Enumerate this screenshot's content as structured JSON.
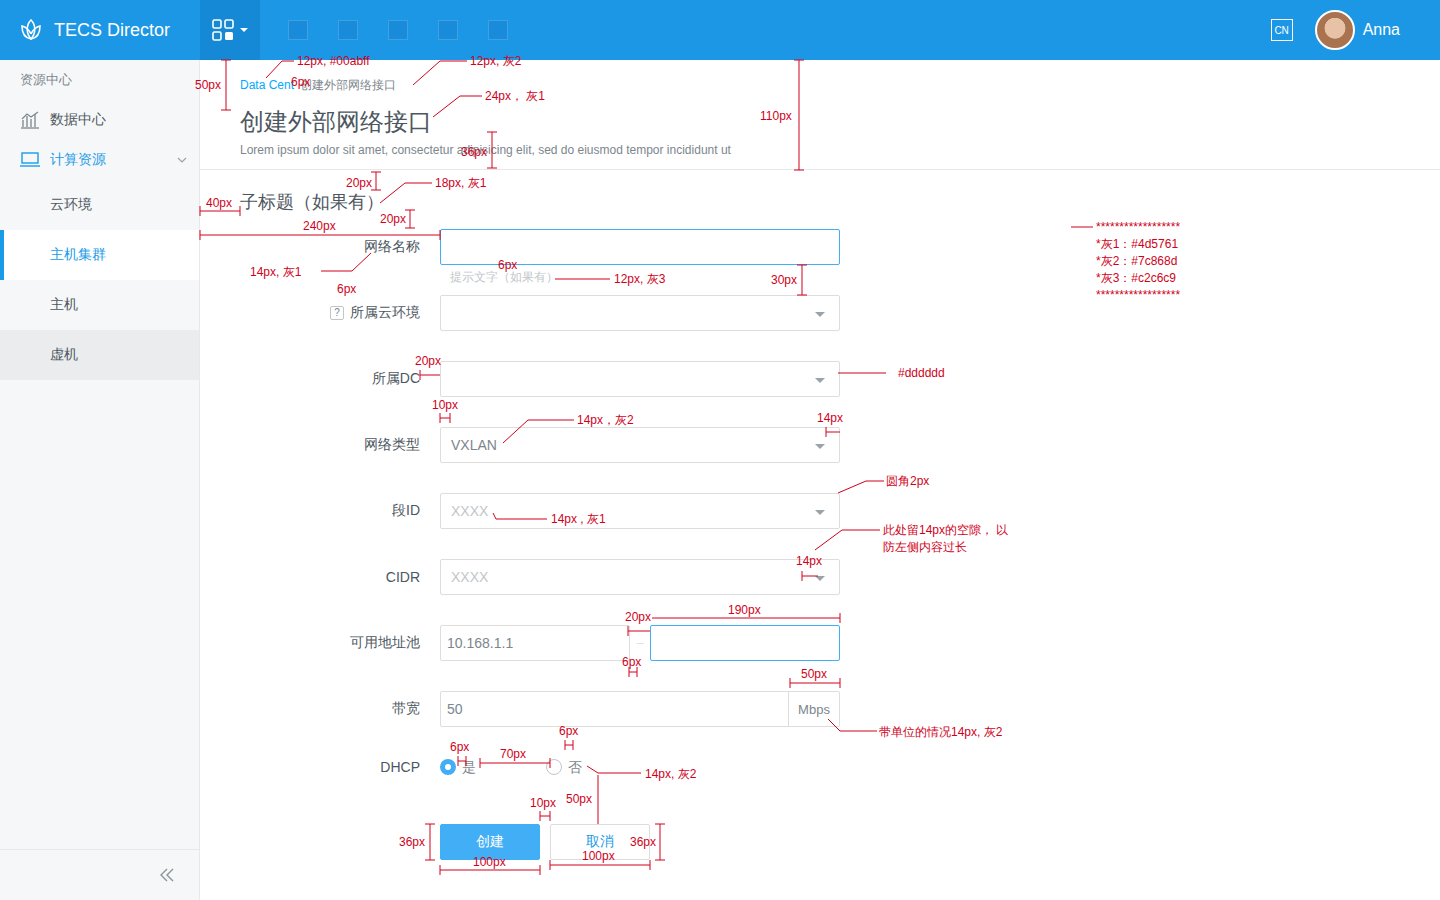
{
  "header": {
    "product": "TECS Director",
    "lang": "CN",
    "user": "Anna"
  },
  "sidebar": {
    "section": "资源中心",
    "items": [
      {
        "label": "数据中心",
        "selected": false,
        "expanded": false,
        "children": []
      },
      {
        "label": "计算资源",
        "selected": true,
        "expanded": true,
        "children": [
          {
            "label": "云环境",
            "selected": false,
            "hovered": false
          },
          {
            "label": "主机集群",
            "selected": true,
            "hovered": false
          },
          {
            "label": "主机",
            "selected": false,
            "hovered": false
          },
          {
            "label": "虚机",
            "selected": false,
            "hovered": true
          }
        ]
      }
    ]
  },
  "breadcrumb": [
    {
      "label": "Data Cent",
      "link": true
    },
    {
      "label": "创建外部网络接口",
      "link": false
    }
  ],
  "page": {
    "title": "创建外部网络接口",
    "description": "Lorem ipsum dolor sit amet, consectetur adipisicing elit, sed do eiusmod tempor incididunt ut",
    "subtitle": "子标题（如果有）"
  },
  "form": {
    "rows": [
      {
        "label": "网络名称",
        "kind": "text",
        "value": "",
        "placeholder": "",
        "hint": "提示文字（如果有）",
        "help": "",
        "focused": true
      },
      {
        "label": "所属云环境",
        "kind": "select",
        "value": "",
        "placeholder": "",
        "hint": "",
        "help": "?",
        "focused": false
      },
      {
        "label": "所属DC",
        "kind": "select",
        "value": "",
        "placeholder": "",
        "hint": "",
        "help": "",
        "focused": false
      },
      {
        "label": "网络类型",
        "kind": "select",
        "value": "VXLAN",
        "placeholder": "",
        "hint": "",
        "help": "",
        "focused": false
      },
      {
        "label": "段ID",
        "kind": "select",
        "value": "",
        "placeholder": "XXXX",
        "hint": "",
        "help": "",
        "focused": false
      },
      {
        "label": "CIDR",
        "kind": "select",
        "value": "",
        "placeholder": "XXXX",
        "hint": "",
        "help": "",
        "focused": false
      },
      {
        "label": "可用地址池",
        "kind": "range",
        "from": {
          "value": "10.168.1.1",
          "focused": false
        },
        "separator": "–",
        "to": {
          "value": "",
          "focused": true
        }
      },
      {
        "label": "带宽",
        "kind": "unit",
        "value": "50",
        "unit": "Mbps",
        "focused": false
      },
      {
        "label": "DHCP",
        "kind": "radio",
        "options": [
          {
            "label": "是",
            "selected": true
          },
          {
            "label": "否",
            "selected": false
          }
        ]
      }
    ],
    "buttons": [
      {
        "label": "创建",
        "primary": true
      },
      {
        "label": "取消",
        "primary": false
      }
    ]
  },
  "annotations": [
    {
      "text": "12px, #00abff"
    },
    {
      "text": "6px"
    },
    {
      "text": "12px, 灰2"
    },
    {
      "text": "50px"
    },
    {
      "text": "24px， 灰1"
    },
    {
      "text": "110px"
    },
    {
      "text": "36px"
    },
    {
      "text": "20px"
    },
    {
      "text": "18px, 灰1"
    },
    {
      "text": "40px"
    },
    {
      "text": "20px"
    },
    {
      "text": "240px"
    },
    {
      "text": "14px, 灰1"
    },
    {
      "text": "6px"
    },
    {
      "text": "12px, 灰3"
    },
    {
      "text": "30px"
    },
    {
      "text": "6px"
    },
    {
      "text": "20px"
    },
    {
      "text": "#dddddd"
    },
    {
      "text": "10px"
    },
    {
      "text": "14px，灰2"
    },
    {
      "text": "14px"
    },
    {
      "text": "圆角2px"
    },
    {
      "text": "14px , 灰1"
    },
    {
      "text": "此处留14px的空隙， 以"
    },
    {
      "text": "防左侧内容过长"
    },
    {
      "text": "14px"
    },
    {
      "text": "20px"
    },
    {
      "text": "190px"
    },
    {
      "text": "6px"
    },
    {
      "text": "50px"
    },
    {
      "text": "带单位的情况14px, 灰2"
    },
    {
      "text": "6px"
    },
    {
      "text": "6px"
    },
    {
      "text": "70px"
    },
    {
      "text": "14px, 灰2"
    },
    {
      "text": "10px"
    },
    {
      "text": "50px"
    },
    {
      "text": "36px"
    },
    {
      "text": "36px"
    },
    {
      "text": "100px"
    },
    {
      "text": "100px"
    }
  ],
  "legend": [
    "******************",
    "*灰1：#4d5761",
    "*灰2：#7c868d",
    "*灰3：#c2c6c9",
    "******************"
  ]
}
